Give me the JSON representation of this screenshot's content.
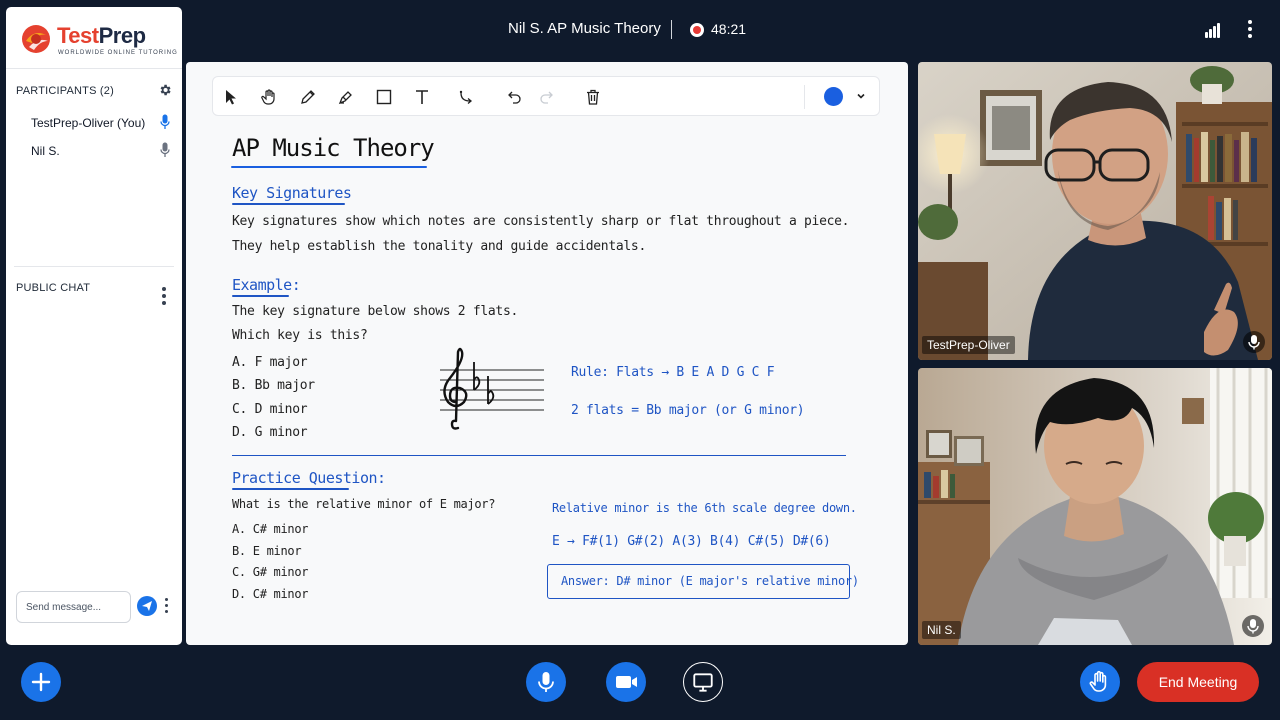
{
  "header": {
    "meeting_title": "Nil S. AP Music Theory",
    "recording_time": "48:21"
  },
  "brand": {
    "name_part1": "Test",
    "name_part2": "Prep",
    "tagline": "WORLDWIDE ONLINE TUTORING"
  },
  "participants": {
    "heading": "PARTICIPANTS (2)",
    "items": [
      {
        "name": "TestPrep-Oliver (You)",
        "mic": "active"
      },
      {
        "name": "Nil S.",
        "mic": "idle"
      }
    ]
  },
  "chat": {
    "heading": "PUBLIC CHAT",
    "placeholder": "Send message..."
  },
  "whiteboard": {
    "title": "AP Music Theory",
    "section1_heading": "Key Signatures",
    "section1_line1": "Key signatures show which notes are consistently sharp or flat throughout a piece.",
    "section1_line2": "They help establish the tonality and guide accidentals.",
    "example_heading": "Example:",
    "example_line1": "The key signature below shows 2 flats.",
    "example_line2": "Which key is this?",
    "example_options": [
      "A.  F major",
      "B.  Bb major",
      "C.  D minor",
      "D.  G minor"
    ],
    "rule_line": "Rule: Flats → B E A D G C F",
    "flats_line": "2 flats = Bb major (or G minor)",
    "practice_heading": "Practice Question:",
    "practice_question": "What is the relative minor of E major?",
    "practice_options": [
      "A.  C# minor",
      "B.  E minor",
      "C.  G# minor",
      "D.  C# minor"
    ],
    "hint_line": "Relative minor is the 6th scale degree down.",
    "scale_line": "E → F#(1) G#(2) A(3) B(4) C#(5) D#(6)",
    "answer_line": "Answer: D# minor (E major's relative minor)",
    "pen_color": "#1a5fe0"
  },
  "videos": {
    "tutor_name": "TestPrep-Oliver",
    "student_name": "Nil S."
  },
  "controls": {
    "end_label": "End Meeting"
  },
  "colors": {
    "background": "#0f1a2c",
    "accent": "#1a73e8",
    "end": "#d93025",
    "record": "#e53935"
  }
}
